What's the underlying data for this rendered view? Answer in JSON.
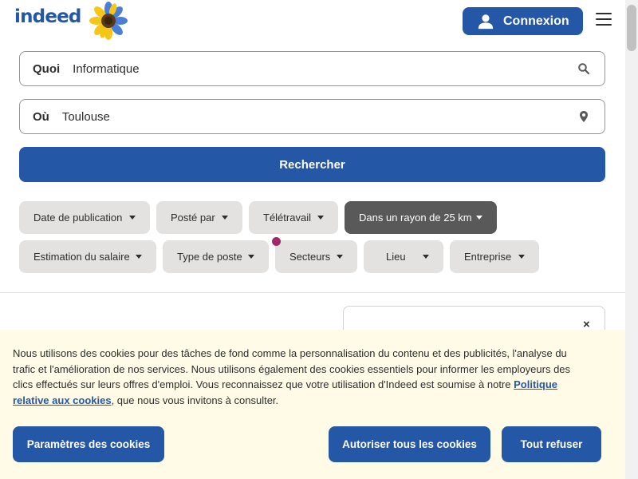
{
  "header": {
    "logo_text": "indeed",
    "login_label": "Connexion"
  },
  "search": {
    "what": {
      "label": "Quoi",
      "value": "Informatique"
    },
    "where": {
      "label": "Où",
      "value": "Toulouse"
    },
    "submit_label": "Rechercher"
  },
  "filters": {
    "row1": [
      {
        "label": "Date de publication",
        "active": false
      },
      {
        "label": "Posté par",
        "active": false
      },
      {
        "label": "Télétravail",
        "active": false
      },
      {
        "label": "Dans un rayon de 25 km",
        "active": true
      }
    ],
    "row2": [
      {
        "label": "Estimation du salaire",
        "active": false
      },
      {
        "label": "Type de poste",
        "active": false
      },
      {
        "label": "Secteurs",
        "active": false
      },
      {
        "label": "Lieu",
        "active": false
      },
      {
        "label": "Entreprise",
        "active": false
      }
    ]
  },
  "card": {
    "close_label": "×"
  },
  "cookie": {
    "text_before": "Nous utilisons des cookies pour des tâches de fond comme la personnalisation du contenu et des publicités, l'analyse du trafic et l'amélioration de nos services. Nous utilisons également des cookies essentiels pour informer les employeurs des clics effectués sur leurs offres d'emploi. Vous reconnaissez que votre utilisation d'Indeed est soumise à notre ",
    "link_label": "Politique relative aux cookies",
    "text_after": ", que nous vous invitons à consulter.",
    "settings_label": "Paramètres des cookies",
    "accept_label": "Autoriser tous les cookies",
    "refuse_label": "Tout refuser"
  },
  "colors": {
    "brand": "#2557a7",
    "chip_bg": "#e4e2e0",
    "chip_active_bg": "#595959",
    "banner_bg": "#fffbe6",
    "dot": "#a6266e"
  },
  "icons": [
    "sunflower-icon",
    "user-icon",
    "hamburger-menu-icon",
    "search-icon",
    "location-pin-icon",
    "caret-down-icon",
    "close-icon"
  ]
}
